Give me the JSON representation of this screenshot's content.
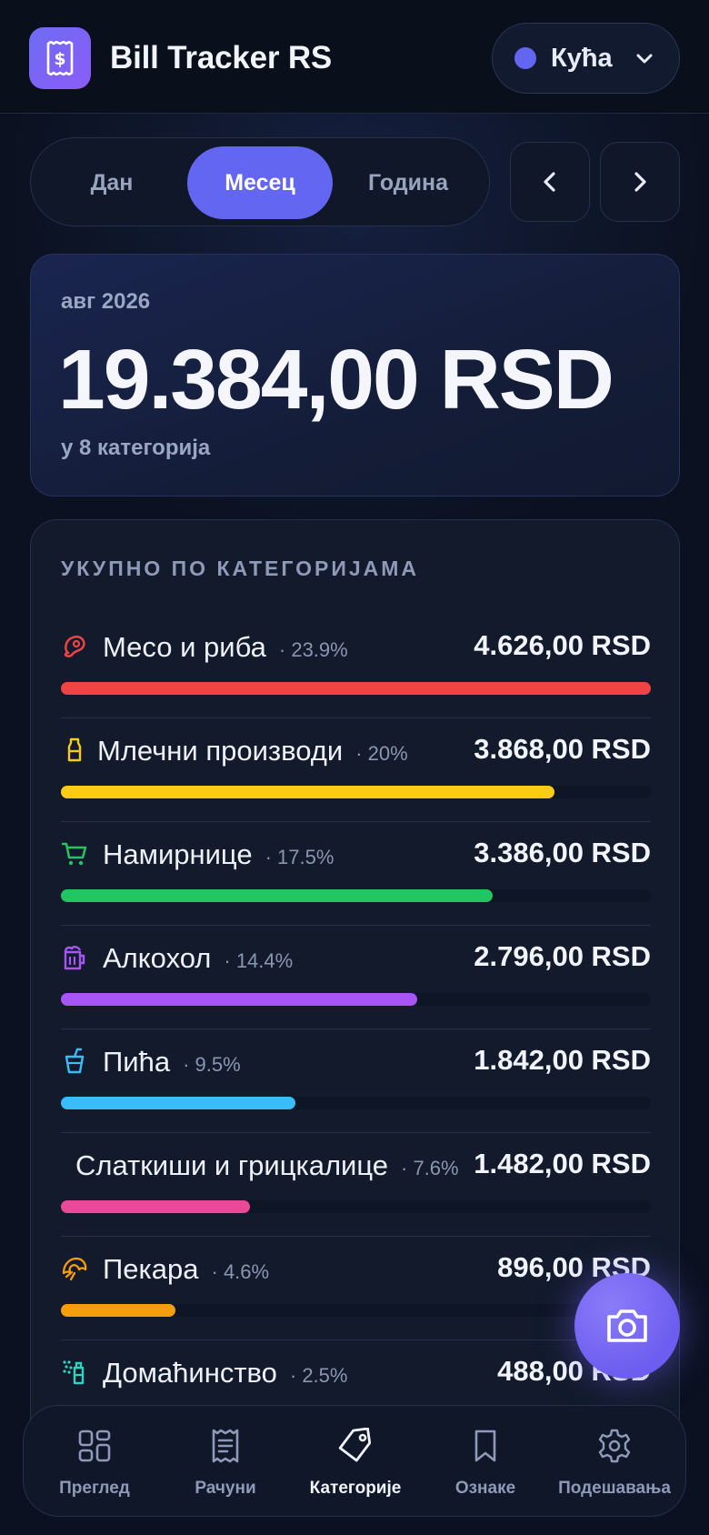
{
  "header": {
    "app_title": "Bill Tracker RS",
    "logo_icon": "receipt-dollar-icon",
    "household": {
      "label": "Кућа",
      "dot_color": "#6366f1",
      "icon": "chevron-down-icon"
    }
  },
  "period": {
    "tabs": [
      {
        "label": "Дан",
        "active": false
      },
      {
        "label": "Месец",
        "active": true
      },
      {
        "label": "Година",
        "active": false
      }
    ],
    "prev_icon": "chevron-left-icon",
    "next_icon": "chevron-right-icon"
  },
  "summary": {
    "period_label": "авг 2026",
    "total": "19.384,00 RSD",
    "subtitle": "у 8 категорија"
  },
  "categories": {
    "heading": "УКУПНО ПО КАТЕГОРИЈАМА",
    "items": [
      {
        "name": "Месо и риба",
        "percent": "· 23.9%",
        "amount": "4.626,00 RSD",
        "color": "#ef4444",
        "fill": 1.0,
        "icon": "meat-icon"
      },
      {
        "name": "Млечни производи",
        "percent": "· 20%",
        "amount": "3.868,00 RSD",
        "color": "#facc15",
        "fill": 0.836,
        "icon": "milk-bottle-icon"
      },
      {
        "name": "Намирнице",
        "percent": "· 17.5%",
        "amount": "3.386,00 RSD",
        "color": "#22c55e",
        "fill": 0.732,
        "icon": "shopping-cart-icon"
      },
      {
        "name": "Алкохол",
        "percent": "· 14.4%",
        "amount": "2.796,00 RSD",
        "color": "#a855f7",
        "fill": 0.604,
        "icon": "beer-mug-icon"
      },
      {
        "name": "Пића",
        "percent": "· 9.5%",
        "amount": "1.842,00 RSD",
        "color": "#38bdf8",
        "fill": 0.398,
        "icon": "cup-straw-icon"
      },
      {
        "name": "Слаткиши и грицкалице",
        "percent": "· 7.6%",
        "amount": "1.482,00 RSD",
        "color": "#ec4899",
        "fill": 0.32,
        "icon": "candy-icon"
      },
      {
        "name": "Пекара",
        "percent": "· 4.6%",
        "amount": "896,00 RSD",
        "color": "#f59e0b",
        "fill": 0.194,
        "icon": "croissant-icon"
      },
      {
        "name": "Домаћинство",
        "percent": "· 2.5%",
        "amount": "488,00 RSD",
        "color": "#2dd4bf",
        "fill": 0.105,
        "icon": "spray-bottle-icon"
      }
    ]
  },
  "fab": {
    "icon": "camera-icon"
  },
  "bottom_nav": [
    {
      "label": "Преглед",
      "icon": "dashboard-grid-icon",
      "active": false
    },
    {
      "label": "Рачуни",
      "icon": "receipt-icon",
      "active": false
    },
    {
      "label": "Категорије",
      "icon": "tag-icon",
      "active": true
    },
    {
      "label": "Ознаке",
      "icon": "bookmark-icon",
      "active": false
    },
    {
      "label": "Подешавања",
      "icon": "gear-icon",
      "active": false
    }
  ]
}
